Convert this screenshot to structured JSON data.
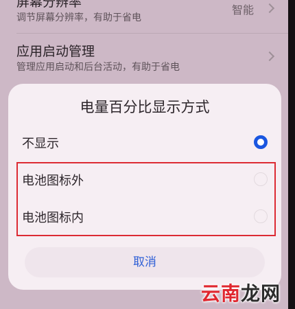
{
  "settings": {
    "resolution": {
      "title": "屏幕分辨率",
      "subtitle": "调节屏幕分辨率，有助于省电",
      "value": "智能"
    },
    "app_launch": {
      "title": "应用启动管理",
      "subtitle": "管理应用启动和后台活动，有助于省电"
    }
  },
  "dialog": {
    "title": "电量百分比显示方式",
    "options": [
      {
        "label": "不显示",
        "selected": true
      },
      {
        "label": "电池图标外",
        "selected": false
      },
      {
        "label": "电池图标内",
        "selected": false
      }
    ],
    "cancel_label": "取消"
  },
  "watermark": {
    "chars": [
      "云",
      "南",
      "龙",
      "网"
    ]
  },
  "colors": {
    "accent": "#1a56e0",
    "highlight_border": "#dc2a33",
    "watermark_yun_nan": "#e0262e",
    "watermark_long_wang": "#2b2b2b"
  }
}
